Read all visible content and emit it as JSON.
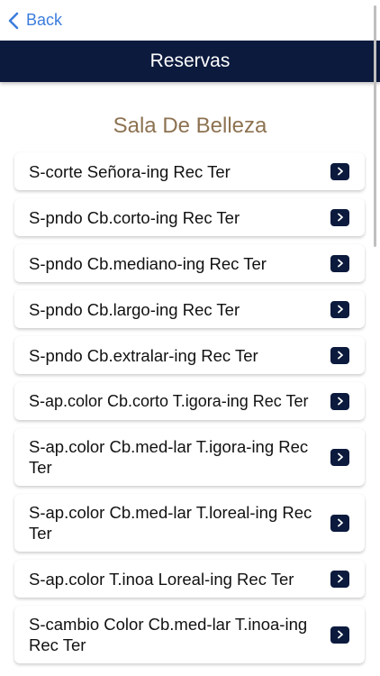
{
  "nav": {
    "back_label": "Back",
    "back_icon": "chevron-left-icon",
    "accent_color": "#3b7ddd"
  },
  "header": {
    "title": "Reservas",
    "background_color": "#0b1a3d"
  },
  "section": {
    "title": "Sala De Belleza",
    "title_color": "#8d7251"
  },
  "items": [
    {
      "label": "S-corte Señora-ing Rec Ter",
      "icon": "chevron-right-icon"
    },
    {
      "label": "S-pndo Cb.corto-ing Rec Ter",
      "icon": "chevron-right-icon"
    },
    {
      "label": "S-pndo Cb.mediano-ing Rec Ter",
      "icon": "chevron-right-icon"
    },
    {
      "label": "S-pndo Cb.largo-ing Rec Ter",
      "icon": "chevron-right-icon"
    },
    {
      "label": "S-pndo Cb.extralar-ing Rec Ter",
      "icon": "chevron-right-icon"
    },
    {
      "label": "S-ap.color Cb.corto T.igora-ing Rec Ter",
      "icon": "chevron-right-icon"
    },
    {
      "label": "S-ap.color Cb.med-lar T.igora-ing Rec Ter",
      "icon": "chevron-right-icon"
    },
    {
      "label": "S-ap.color Cb.med-lar T.loreal-ing Rec Ter",
      "icon": "chevron-right-icon"
    },
    {
      "label": "S-ap.color T.inoa Loreal-ing Rec Ter",
      "icon": "chevron-right-icon"
    },
    {
      "label": "S-cambio Color Cb.med-lar T.inoa-ing Rec Ter",
      "icon": "chevron-right-icon"
    }
  ]
}
